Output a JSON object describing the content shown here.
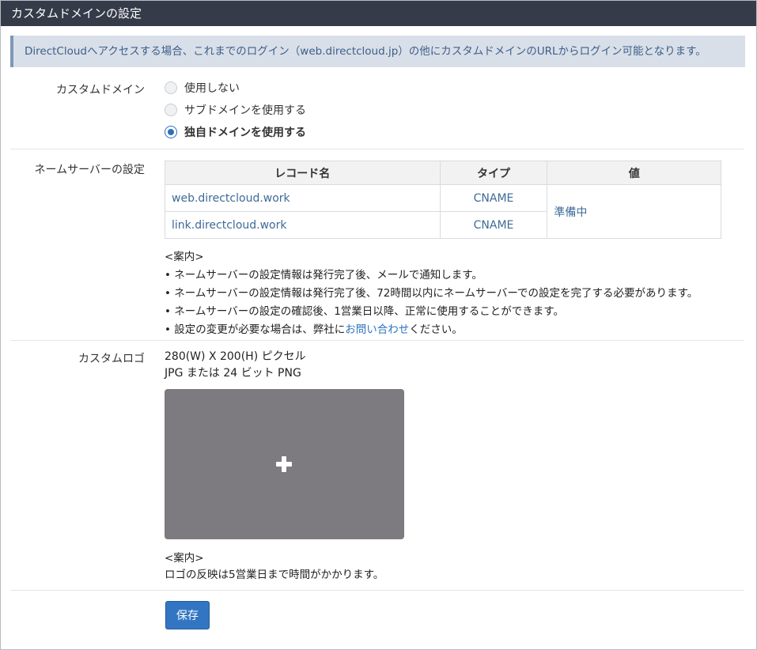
{
  "header": {
    "title": "カスタムドメインの設定"
  },
  "notice": {
    "text": "DirectCloudへアクセスする場合、これまでのログイン（web.directcloud.jp）の他にカスタムドメインのURLからログイン可能となります。"
  },
  "custom_domain": {
    "label": "カスタムドメイン",
    "options": [
      {
        "label": "使用しない",
        "checked": false
      },
      {
        "label": "サブドメインを使用する",
        "checked": false
      },
      {
        "label": "独自ドメインを使用する",
        "checked": true
      }
    ]
  },
  "nameserver": {
    "label": "ネームサーバーの設定",
    "columns": [
      "レコード名",
      "タイプ",
      "値"
    ],
    "rows": [
      {
        "record": "web.directcloud.work",
        "type": "CNAME"
      },
      {
        "record": "link.directcloud.work",
        "type": "CNAME"
      }
    ],
    "value": "準備中",
    "notes_title": "<案内>",
    "notes": [
      "• ネームサーバーの設定情報は発行完了後、メールで通知します。",
      "• ネームサーバーの設定情報は発行完了後、72時間以内にネームサーバーでの設定を完了する必要があります。",
      "• ネームサーバーの設定の確認後、1営業日以降、正常に使用することができます。"
    ],
    "note_last_prefix": "• 設定の変更が必要な場合は、弊社に",
    "note_last_link": "お問い合わせ",
    "note_last_suffix": "ください。"
  },
  "custom_logo": {
    "label": "カスタムロゴ",
    "spec_size": "280(W) X 200(H) ピクセル",
    "spec_format": "JPG または 24 ビット PNG",
    "upload_icon": "plus-icon",
    "notes_title": "<案内>",
    "note": "ロゴの反映は5営業日まで時間がかかります。"
  },
  "actions": {
    "save_label": "保存"
  },
  "colors": {
    "header_bg": "#353b48",
    "notice_bg": "#d8dfe8",
    "accent": "#3276c3",
    "link": "#2f74c0",
    "upload_bg": "#7d7b80"
  }
}
